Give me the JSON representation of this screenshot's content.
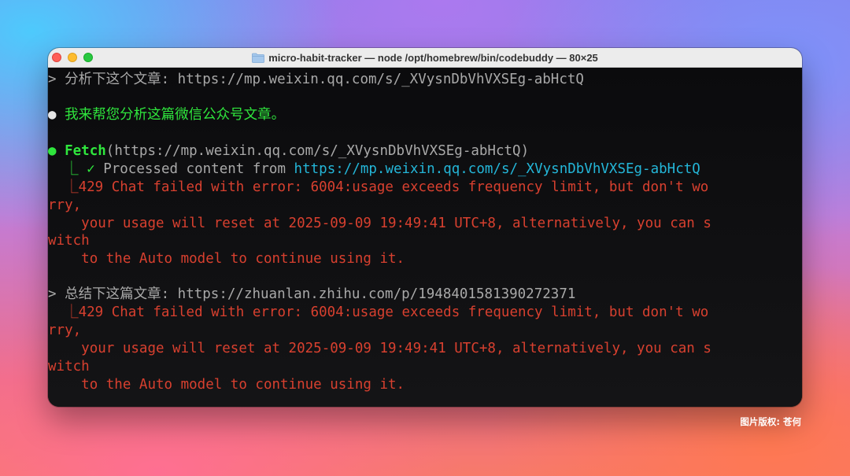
{
  "window": {
    "title": "micro-habit-tracker — node /opt/homebrew/bin/codebuddy — 80×25",
    "folder_icon": "folder-icon"
  },
  "terminal": {
    "prompt1": {
      "marker": ">",
      "text": "分析下这个文章: https://mp.weixin.qq.com/s/_XVysnDbVhVXSEg-abHctQ"
    },
    "bullet1": {
      "marker": "●",
      "text": "我来帮您分析这篇微信公众号文章。"
    },
    "tool": {
      "marker": "●",
      "name": "Fetch",
      "args": "(https://mp.weixin.qq.com/s/_XVysnDbVhVXSEg-abHctQ)",
      "result_prefix": "⎿ ✓",
      "result_text": "Processed content from",
      "result_url": "https://mp.weixin.qq.com/s/_XVysnDbVhVXSEg-abHctQ",
      "error": {
        "prefix": "⎿",
        "l1": "429 Chat failed with error: 6004:usage exceeds frequency limit, but don't wo",
        "l2": "rry,",
        "l3": "your usage will reset at 2025-09-09 19:49:41 UTC+8, alternatively, you can s",
        "l4": "witch",
        "l5": "to the Auto model to continue using it."
      }
    },
    "prompt2": {
      "marker": ">",
      "text": "总结下这篇文章: https://zhuanlan.zhihu.com/p/1948401581390272371",
      "error": {
        "prefix": "⎿",
        "l1": "429 Chat failed with error: 6004:usage exceeds frequency limit, but don't wo",
        "l2": "rry,",
        "l3": "your usage will reset at 2025-09-09 19:49:41 UTC+8, alternatively, you can s",
        "l4": "witch",
        "l5": "to the Auto model to continue using it."
      }
    }
  },
  "colors": {
    "prompt": "#a9a9a9",
    "assistant": "#2fe63d",
    "link": "#24b6d8",
    "error": "#d8402f"
  },
  "credit": "图片版权: 苍何"
}
